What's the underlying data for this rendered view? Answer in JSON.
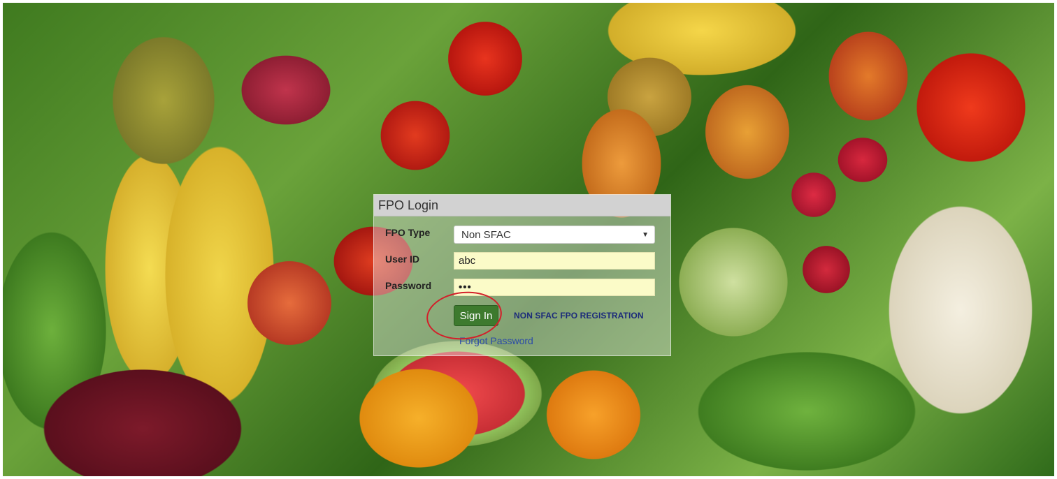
{
  "login": {
    "title": "FPO Login",
    "fpo_type_label": "FPO Type",
    "fpo_type_selected": "Non SFAC",
    "user_id_label": "User ID",
    "user_id_value": "abc",
    "password_label": "Password",
    "password_mask": "•••",
    "sign_in_label": "Sign In",
    "registration_link": "NON SFAC FPO REGISTRATION",
    "forgot_password_link": "Forgot Password"
  },
  "colors": {
    "sign_in_button": "#3d7a2e",
    "input_background": "#fbfbc8",
    "annotation_circle": "#d31f2a",
    "link": "#1b2a7a"
  },
  "icons": {
    "dropdown": "chevron-down-icon"
  }
}
